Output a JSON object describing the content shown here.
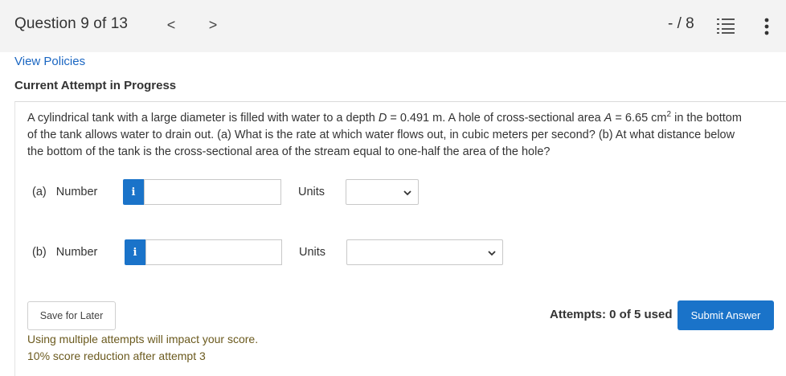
{
  "header": {
    "question_position": "Question 9 of 13",
    "prev_label": "<",
    "next_label": ">",
    "score": "- / 8"
  },
  "links": {
    "view_policies": "View Policies"
  },
  "attempt_heading": "Current Attempt in Progress",
  "question": {
    "part1": "A cylindrical tank with a large diameter is filled with water to a depth ",
    "var_D": "D",
    "part2": " = 0.491 m. A hole of cross-sectional area ",
    "var_A": "A",
    "part3": " = 6.65 cm",
    "sup": "2",
    "part4": " in the bottom of the tank allows water to drain out. (a) What is the rate at which water flows out, in cubic meters per second? (b) At what distance below the bottom of the tank is the cross-sectional area of the stream equal to one-half the area of the hole?"
  },
  "parts": [
    {
      "label": "(a)   Number",
      "info": "i",
      "value": "",
      "units_label": "Units",
      "unit_selected": ""
    },
    {
      "label": "(b)   Number",
      "info": "i",
      "value": "",
      "units_label": "Units",
      "unit_selected": ""
    }
  ],
  "footer": {
    "save_label": "Save for Later",
    "attempts": "Attempts: 0 of 5 used",
    "submit_label": "Submit Answer",
    "note_line1": "Using multiple attempts will impact your score.",
    "note_line2": "10% score reduction after attempt 3"
  },
  "colors": {
    "accent": "#1a73c9",
    "link": "#1a66c2",
    "note": "#6b5a1e",
    "topbar_bg": "#f3f3f3"
  },
  "icons": {
    "list": "list-icon",
    "menu": "more-vertical-icon",
    "dropdown": "chevron-down-icon",
    "info": "info-icon"
  }
}
